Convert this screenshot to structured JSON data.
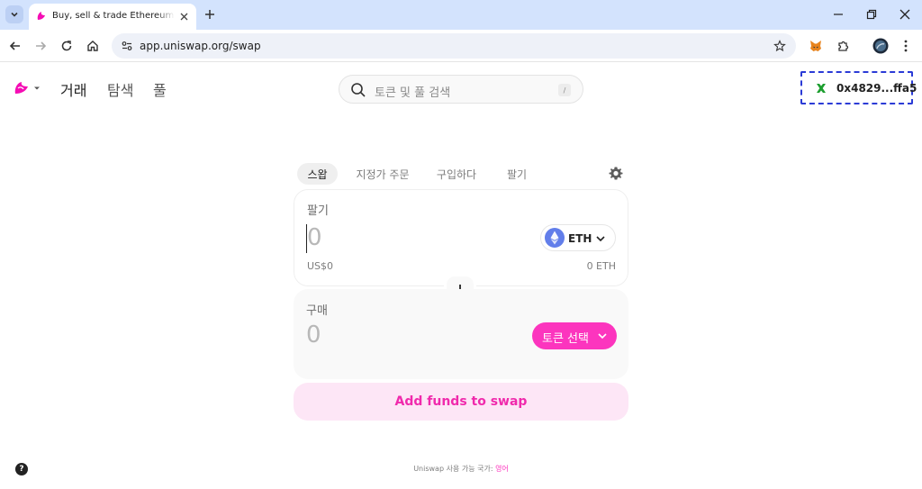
{
  "browser": {
    "tab_title": "Buy, sell & trade Ethereum and",
    "url": "app.uniswap.org/swap"
  },
  "header": {
    "nav": [
      "거래",
      "탐색",
      "풀"
    ],
    "search_placeholder": "토큰 및 풀 검색",
    "search_shortcut": "/",
    "wallet_address": "0x4829...ffa5"
  },
  "swap": {
    "tabs": [
      "스왑",
      "지정가 주문",
      "구입하다",
      "팔기"
    ],
    "active_tab": "스왑",
    "sell": {
      "label": "팔기",
      "amount": "0",
      "usd_value": "US$0",
      "token": "ETH",
      "balance": "0 ETH"
    },
    "buy": {
      "label": "구매",
      "amount": "0",
      "select_token_label": "토큰 선택"
    },
    "cta_label": "Add funds to swap"
  },
  "footer": {
    "text": "Uniswap 사용 가능 국가:",
    "link": "영어"
  },
  "colors": {
    "accent_pink": "#fc35be",
    "cta_bg": "#fde6f6",
    "wallet_border": "#2b3bd6",
    "browser_frame": "#d3e3fd"
  }
}
